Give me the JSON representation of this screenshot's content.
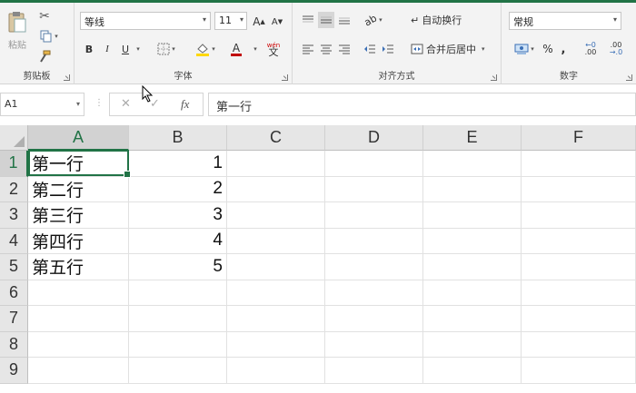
{
  "ribbon": {
    "clipboard": {
      "title": "剪贴板",
      "paste_label": "粘贴"
    },
    "font": {
      "title": "字体",
      "font_name": "等线",
      "font_size": "11",
      "bold": "B",
      "italic": "I",
      "underline": "U",
      "grow": "A",
      "shrink": "A",
      "font_color": "A",
      "phonetic": "wén"
    },
    "alignment": {
      "title": "对齐方式",
      "wrap_text": "自动换行",
      "merge_center": "合并后居中"
    },
    "number": {
      "title": "数字",
      "format": "常规",
      "percent": "%",
      "comma": ",",
      "inc_decimal": ".00",
      "dec_decimal": ".0"
    }
  },
  "formula_bar": {
    "name_box": "A1",
    "fx": "fx",
    "cancel": "✕",
    "enter": "✓",
    "content": "第一行"
  },
  "sheet": {
    "columns": [
      "A",
      "B",
      "C",
      "D",
      "E",
      "F"
    ],
    "rows": [
      "1",
      "2",
      "3",
      "4",
      "5",
      "6",
      "7",
      "8",
      "9"
    ],
    "data": [
      {
        "a": "第一行",
        "b": "1"
      },
      {
        "a": "第二行",
        "b": "2"
      },
      {
        "a": "第三行",
        "b": "3"
      },
      {
        "a": "第四行",
        "b": "4"
      },
      {
        "a": "第五行",
        "b": "5"
      }
    ],
    "active_cell": "A1"
  },
  "colors": {
    "accent": "#217346",
    "header_bg": "#e6e6e6",
    "ribbon_bg": "#f3f3f3"
  }
}
